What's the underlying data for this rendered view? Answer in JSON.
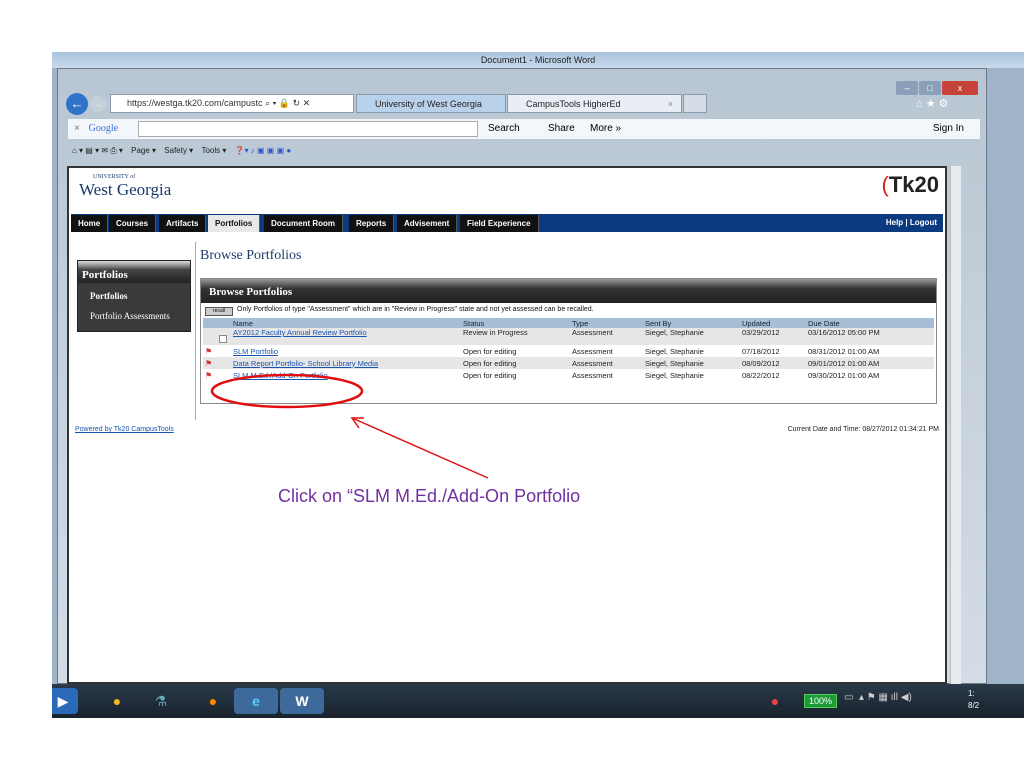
{
  "word_title": "Document1 - Microsoft Word",
  "browser": {
    "address": "https://westga.tk20.com/campustc",
    "tabs": [
      "University of West Georgia",
      "CampusTools HigherEd"
    ],
    "google": {
      "label": "Google",
      "search": "Search",
      "share": "Share",
      "more": "More »",
      "sign_in": "Sign In"
    },
    "commands": [
      "Page ▾",
      "Safety ▾",
      "Tools ▾"
    ]
  },
  "site": {
    "logo_top": "UNIVERSITY of",
    "logo_main": "West Georgia",
    "tk20": "Tk20",
    "nav": [
      "Home",
      "Courses",
      "Artifacts",
      "Portfolios",
      "Document Room",
      "Reports",
      "Advisement",
      "Field Experience"
    ],
    "nav_active": "Portfolios",
    "help": "Help",
    "logout": "Logout",
    "sidebar": {
      "title": "Portfolios",
      "items": [
        "Portfolios",
        "Portfolio Assessments"
      ]
    },
    "page_title": "Browse Portfolios",
    "panel_title": "Browse Portfolios",
    "recall_label": "recall",
    "note": "Only Portfolios of type \"Assessment\" which are in \"Review in Progress\" state and not yet assessed can be recalled.",
    "columns": [
      "Name",
      "Status",
      "Type",
      "Sent By",
      "Updated",
      "Due Date"
    ],
    "rows": [
      {
        "name": "AY2012 Faculty Annual Review Portfolio",
        "status": "Review in Progress",
        "type": "Assessment",
        "sent_by": "Siegel, Stephanie",
        "updated": "03/29/2012",
        "due": "03/16/2012 05:00 PM"
      },
      {
        "name": "SLM Portfolio",
        "status": "Open for editing",
        "type": "Assessment",
        "sent_by": "Siegel, Stephanie",
        "updated": "07/18/2012",
        "due": "08/31/2012 01:00 AM"
      },
      {
        "name": "Data Report Portfolio- School Library Media",
        "status": "Open for editing",
        "type": "Assessment",
        "sent_by": "Siegel, Stephanie",
        "updated": "08/09/2012",
        "due": "09/01/2012 01:00 AM"
      },
      {
        "name": "SLM M.Ed./Add-On Portfolio",
        "status": "Open for editing",
        "type": "Assessment",
        "sent_by": "Siegel, Stephanie",
        "updated": "08/22/2012",
        "due": "09/30/2012 01:00 AM"
      }
    ],
    "powered_by": "Powered by Tk20 CampusTools",
    "current_date": "Current Date and Time: 08/27/2012 01:34:21 PM"
  },
  "taskbar": {
    "battery": "100%",
    "clock_time": "1:",
    "clock_date": "8/2"
  },
  "annotation": {
    "text": "Click on “SLM M.Ed./Add-On Portfolio",
    "color": "#7030a0"
  }
}
